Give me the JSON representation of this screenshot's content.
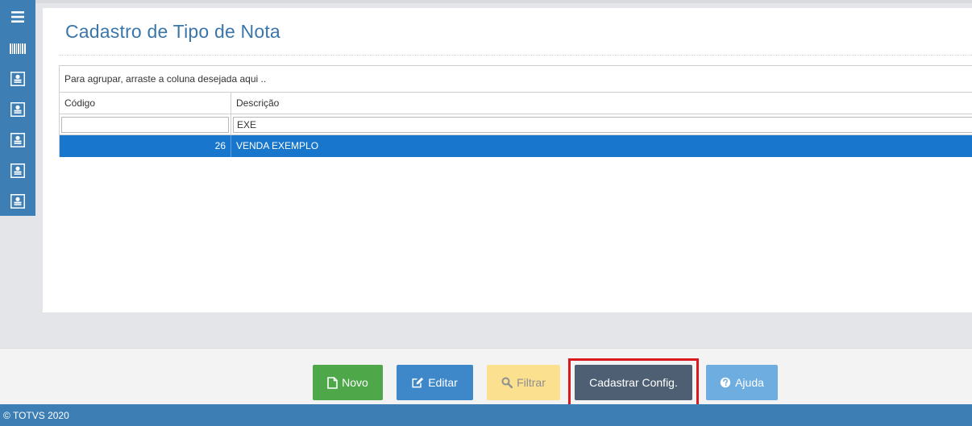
{
  "page": {
    "title": "Cadastro de Tipo de Nota"
  },
  "sidebar": {
    "items": [
      {
        "icon": "menu-icon"
      },
      {
        "icon": "barcode-icon"
      },
      {
        "icon": "contact-card-icon"
      },
      {
        "icon": "contact-card-icon"
      },
      {
        "icon": "contact-card-icon"
      },
      {
        "icon": "contact-card-icon"
      },
      {
        "icon": "contact-card-icon"
      }
    ]
  },
  "grid": {
    "group_hint": "Para agrupar, arraste a coluna desejada aqui ..",
    "columns": [
      "Código",
      "Descrição"
    ],
    "filters": {
      "codigo": "",
      "descricao": "EXE"
    },
    "rows": [
      {
        "codigo": "26",
        "descricao": "VENDA EXEMPLO",
        "selected": true
      }
    ]
  },
  "toolbar": {
    "novo": "Novo",
    "editar": "Editar",
    "filtrar": "Filtrar",
    "cadastrar_config": "Cadastrar Config.",
    "ajuda": "Ajuda"
  },
  "footer": {
    "copyright": "© TOTVS 2020"
  },
  "colors": {
    "accent": "#3d7fb4",
    "title": "#3b76aa",
    "selected_row": "#1877cc",
    "novo": "#4ea84a",
    "editar": "#3e88c9",
    "filtrar": "#fbe08f",
    "cadastrar": "#4e5f73",
    "ajuda": "#6eaddf",
    "highlight": "#d9181f"
  }
}
